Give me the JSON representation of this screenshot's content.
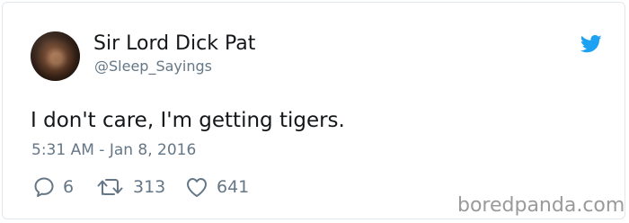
{
  "author": {
    "display_name": "Sir Lord Dick Pat",
    "handle": "@Sleep_Sayings"
  },
  "tweet": {
    "text": "I don't care, I'm getting tigers.",
    "timestamp": "5:31 AM - Jan 8, 2016"
  },
  "actions": {
    "replies": "6",
    "retweets": "313",
    "likes": "641"
  },
  "icons": {
    "brand": "twitter-bird-icon",
    "reply": "reply-icon",
    "retweet": "retweet-icon",
    "like": "heart-icon"
  },
  "colors": {
    "twitter_blue": "#1da1f2",
    "text": "#14171a",
    "muted": "#657786",
    "border": "#e1e8ed"
  },
  "watermark": "boredpanda.com"
}
